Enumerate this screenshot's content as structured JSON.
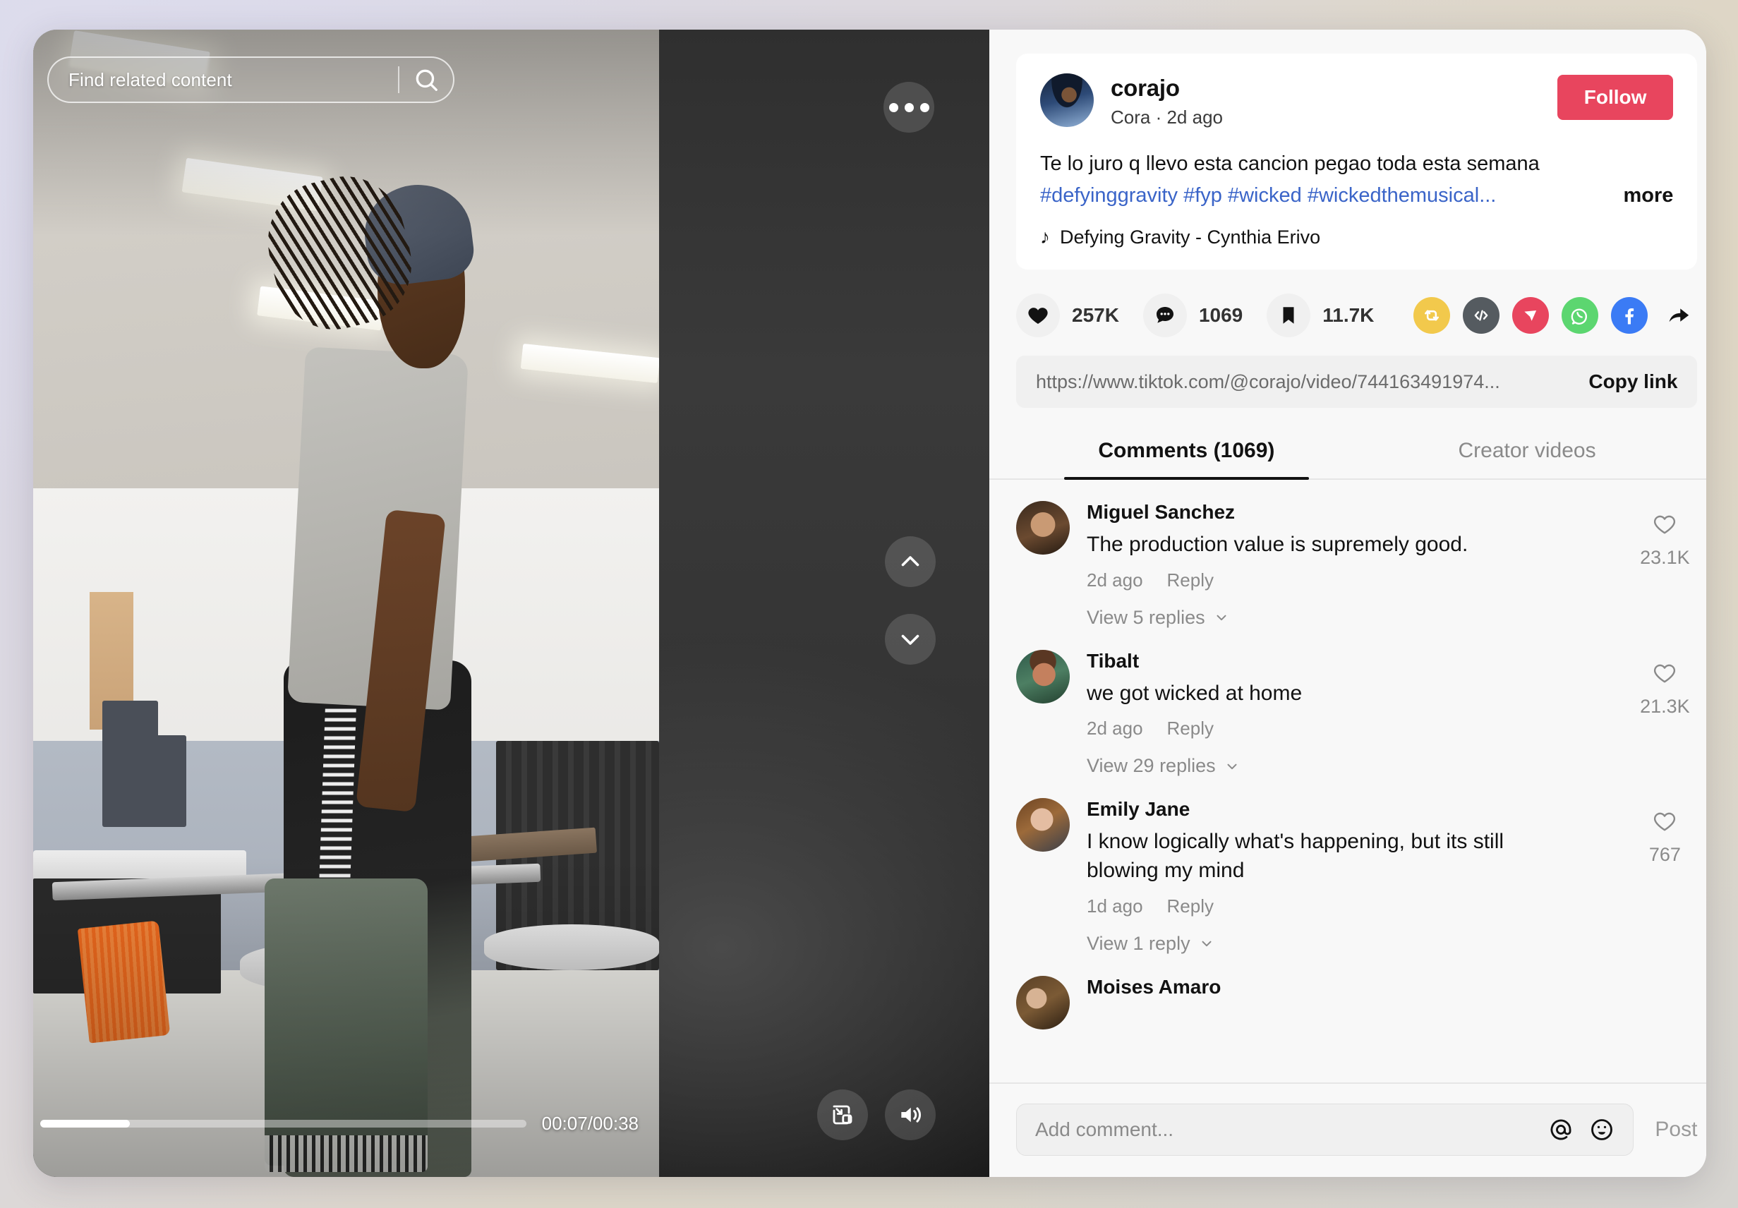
{
  "player": {
    "search_placeholder": "Find related content",
    "search_icon": "search-icon",
    "more_icon": "more-options-icon",
    "prev_icon": "chevron-up-icon",
    "next_icon": "chevron-down-icon",
    "pip_icon": "picture-in-picture-icon",
    "volume_icon": "volume-on-icon",
    "time_display": "00:07/00:38",
    "current_time": "00:07",
    "duration": "00:38",
    "progress_percent": 18.4
  },
  "post": {
    "author_handle": "corajo",
    "author_name": "Cora",
    "posted_ago": "2d ago",
    "author_meta": "Cora · 2d ago",
    "follow_label": "Follow",
    "follow_color": "#E8455E",
    "caption_line1": "Te lo juro q llevo esta cancion pegao toda esta semana",
    "caption_hashtags": "#defyinggravity #fyp #wicked #wickedthemusical...",
    "more_label": "more",
    "music_icon": "music-note-icon",
    "music_title": "Defying Gravity - Cynthia Erivo"
  },
  "actions": {
    "like_icon": "heart-filled-icon",
    "like_count": "257K",
    "comment_icon": "comment-bubble-icon",
    "comment_count": "1069",
    "bookmark_icon": "bookmark-filled-icon",
    "bookmark_count": "11.7K",
    "share_targets": [
      {
        "name": "repost-icon",
        "color": "#F2C94C"
      },
      {
        "name": "embed-icon",
        "color": "#555B60"
      },
      {
        "name": "pinterest-icon",
        "color": "#E8455E"
      },
      {
        "name": "whatsapp-icon",
        "color": "#5CD670"
      },
      {
        "name": "facebook-icon",
        "color": "#3B7BF5"
      },
      {
        "name": "share-arrow-icon",
        "color": "#121212"
      }
    ]
  },
  "link": {
    "url": "https://www.tiktok.com/@corajo/video/744163491974...",
    "copy_label": "Copy link"
  },
  "tabs": [
    {
      "label": "Comments (1069)",
      "active": true
    },
    {
      "label": "Creator videos",
      "active": false
    }
  ],
  "comments": [
    {
      "avatar": "a-miguel",
      "name": "Miguel Sanchez",
      "text": "The production value is supremely good.",
      "time": "2d ago",
      "reply_label": "Reply",
      "replies_label": "View 5 replies",
      "like_icon": "heart-outline-icon",
      "likes": "23.1K"
    },
    {
      "avatar": "a-tibalt",
      "name": "Tibalt",
      "text": "we got wicked at home",
      "time": "2d ago",
      "reply_label": "Reply",
      "replies_label": "View 29 replies",
      "like_icon": "heart-outline-icon",
      "likes": "21.3K"
    },
    {
      "avatar": "a-emily",
      "name": "Emily Jane",
      "text": "I know logically what's happening, but its still blowing my mind",
      "time": "1d ago",
      "reply_label": "Reply",
      "replies_label": "View 1 reply",
      "like_icon": "heart-outline-icon",
      "likes": "767"
    },
    {
      "avatar": "a-moises",
      "name": "Moises Amaro",
      "text": "",
      "time": "",
      "reply_label": "",
      "replies_label": "",
      "like_icon": "heart-outline-icon",
      "likes": ""
    }
  ],
  "composer": {
    "placeholder": "Add comment...",
    "mention_icon": "at-mention-icon",
    "emoji_icon": "emoji-icon",
    "post_label": "Post"
  }
}
